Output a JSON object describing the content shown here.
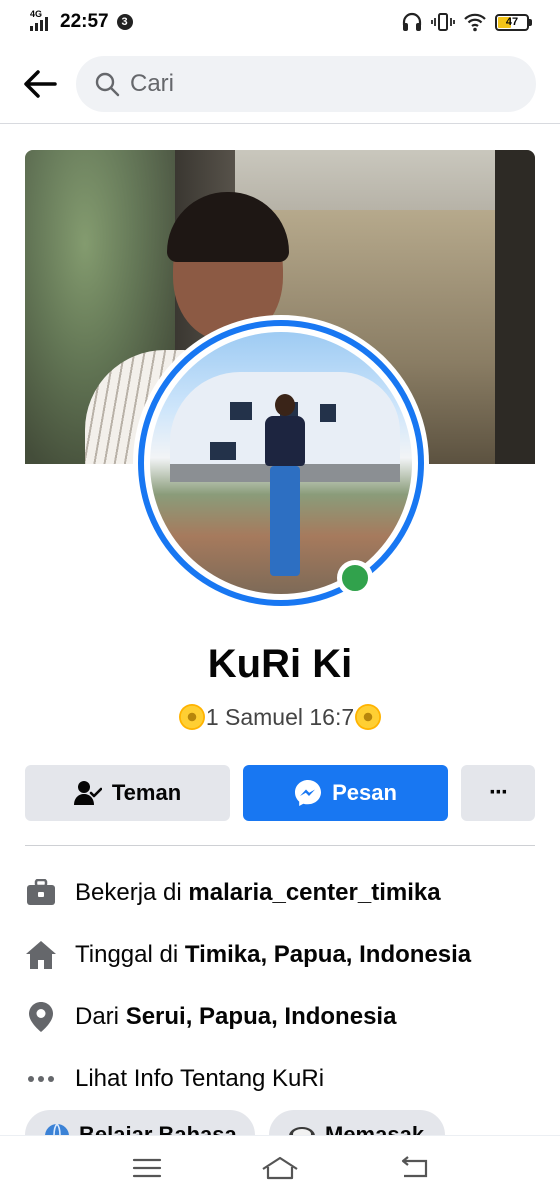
{
  "status_bar": {
    "network": "4G",
    "time": "22:57",
    "notification_count": "3",
    "battery_level": "47",
    "battery_fraction": 0.47
  },
  "search": {
    "placeholder": "Cari",
    "value": ""
  },
  "profile": {
    "name": "KuRi Ki",
    "bio": "1 Samuel 16:7",
    "online": true
  },
  "actions": {
    "friend_label": "Teman",
    "message_label": "Pesan",
    "more_label": "···"
  },
  "info": [
    {
      "icon": "briefcase-icon",
      "prefix": "Bekerja di",
      "value": "malaria_center_timika"
    },
    {
      "icon": "home-icon",
      "prefix": "Tinggal di",
      "value": "Timika, Papua, Indonesia"
    },
    {
      "icon": "location-pin-icon",
      "prefix": "Dari",
      "value": "Serui, Papua, Indonesia"
    },
    {
      "icon": "more-dots-icon",
      "prefix": "Lihat Info Tentang KuRi",
      "value": ""
    }
  ],
  "chips": [
    {
      "icon": "globe-icon",
      "label": "Belajar Bahasa"
    },
    {
      "icon": "chef-hat-icon",
      "label": "Memasak"
    }
  ],
  "colors": {
    "accent": "#1877f2",
    "online": "#31a24c",
    "button_gray": "#e4e6eb",
    "battery": "#f3c418"
  }
}
